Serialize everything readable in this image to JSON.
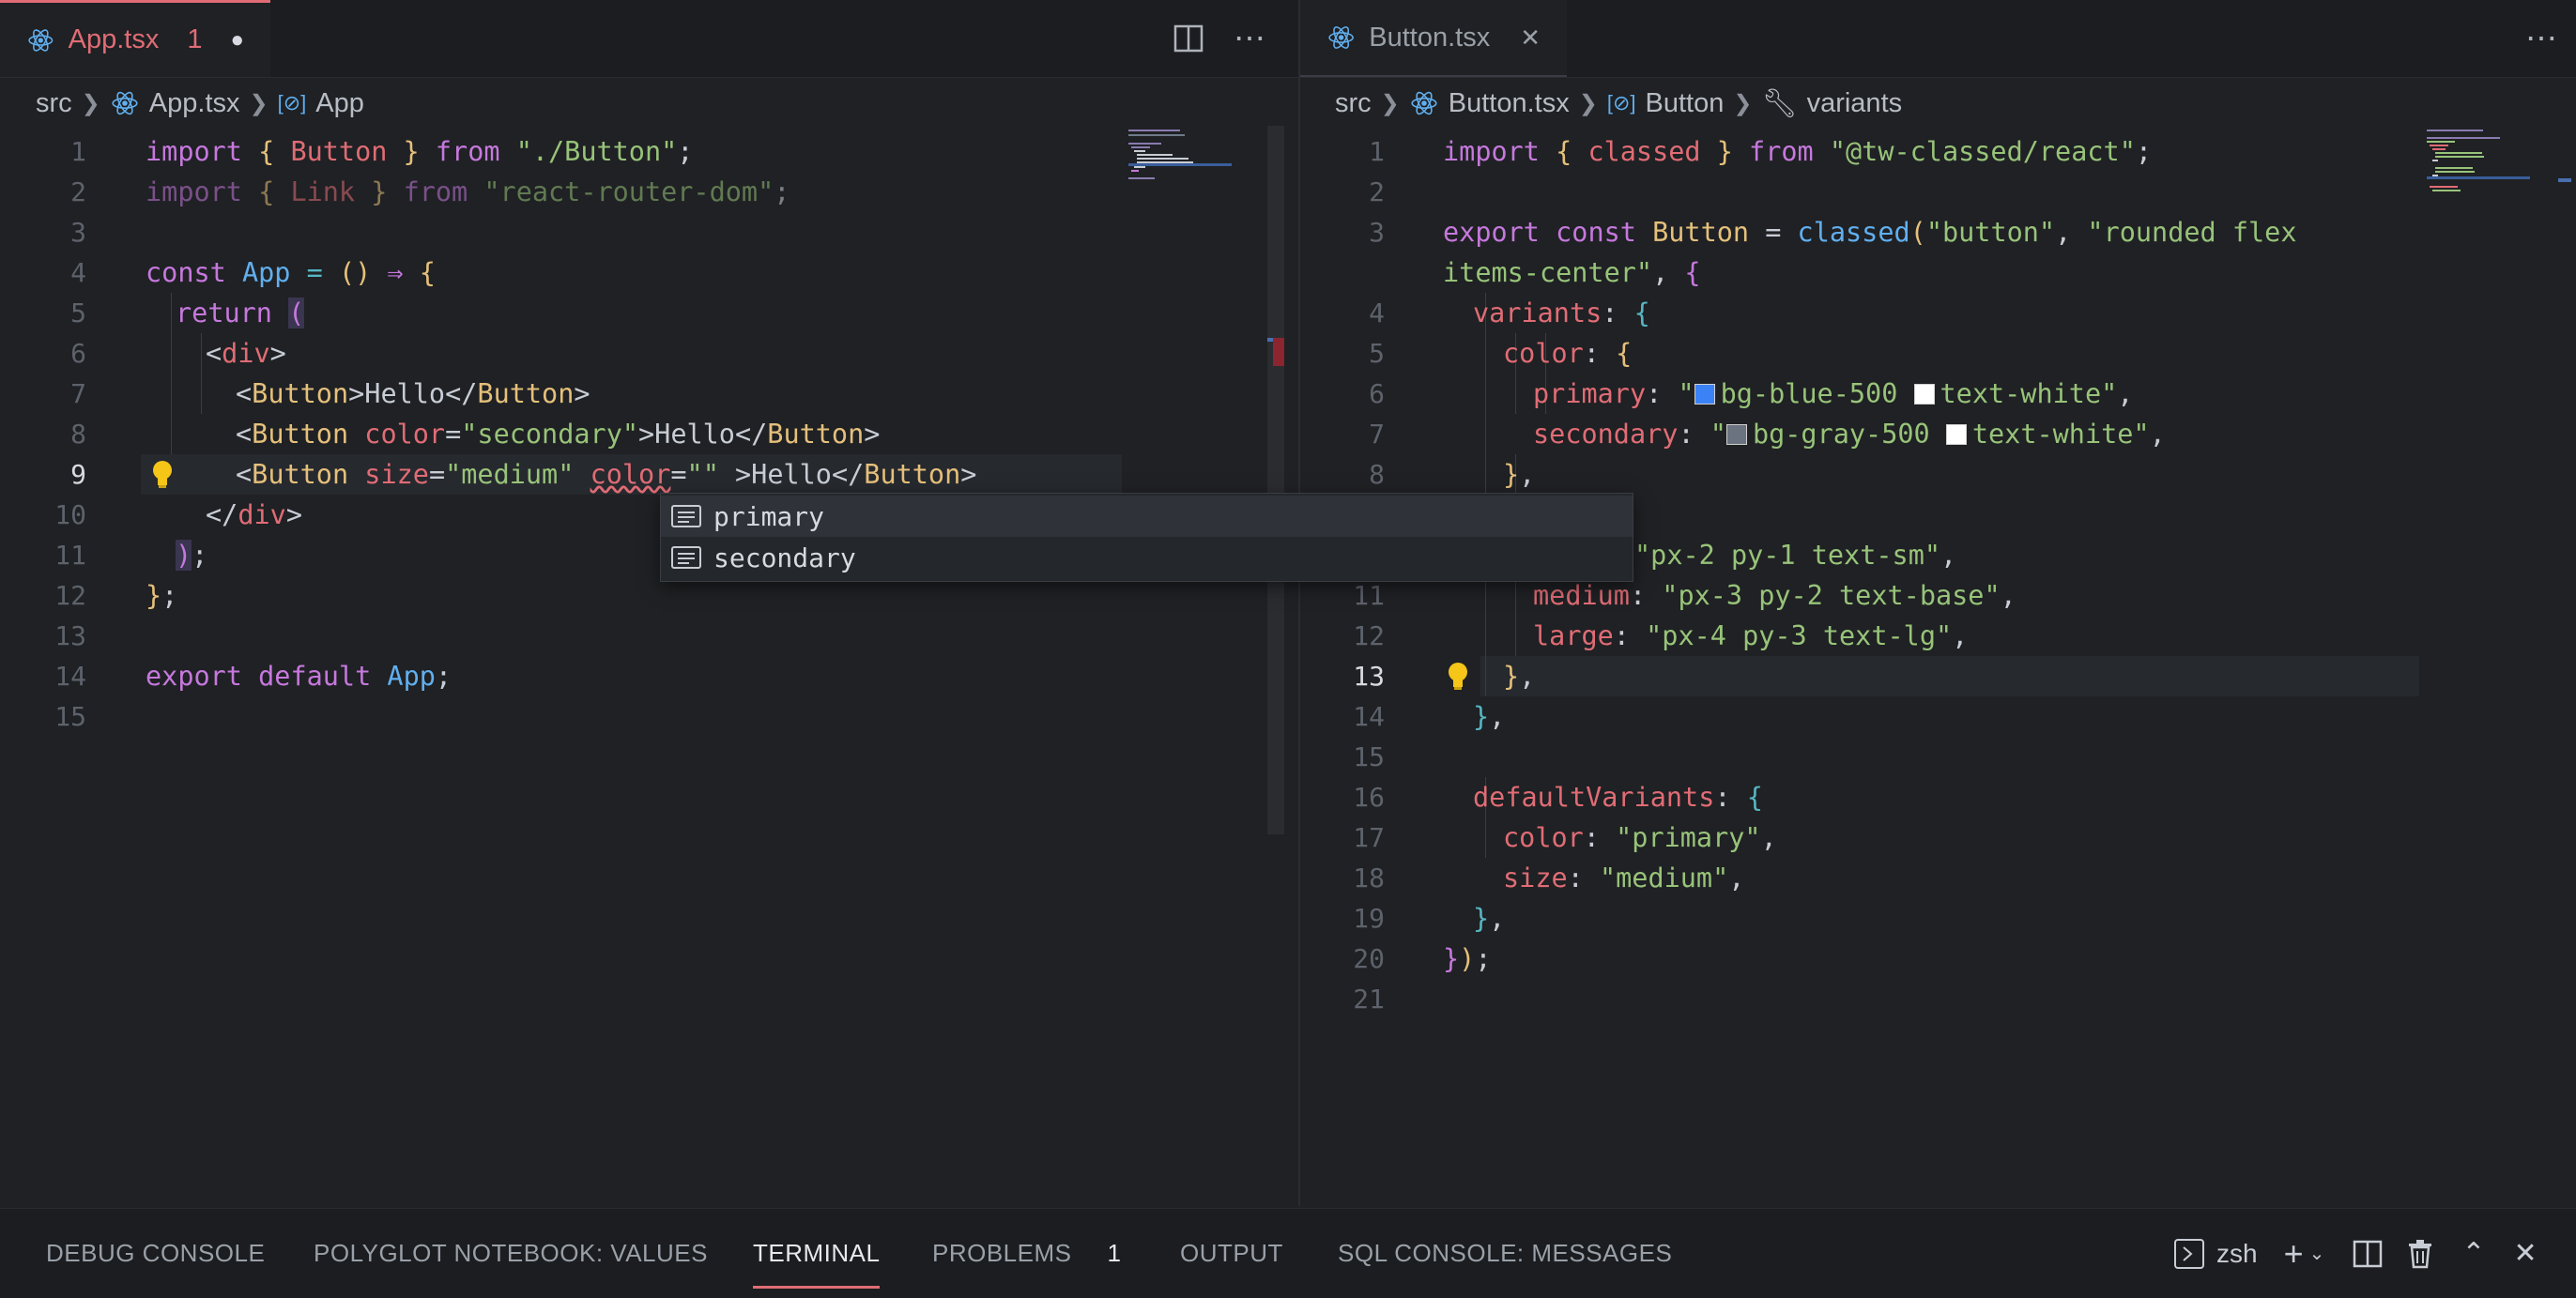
{
  "colors": {
    "accent": "#e06c75",
    "modified_tab": "#e06c75",
    "lightbulb": "#f5c518",
    "swatch_blue": "#3b82f6",
    "swatch_gray": "#6b7280",
    "swatch_white": "#ffffff"
  },
  "left": {
    "tab": {
      "label": "App.tsx",
      "problem_count": "1",
      "dirty_marker": "●",
      "icon": "react-icon"
    },
    "breadcrumb": [
      "src",
      "App.tsx",
      "App"
    ],
    "line_numbers": [
      "1",
      "2",
      "3",
      "4",
      "5",
      "6",
      "7",
      "8",
      "9",
      "10",
      "11",
      "12",
      "13",
      "14",
      "15"
    ],
    "current_line": "9"
  },
  "right": {
    "tab": {
      "label": "Button.tsx",
      "icon": "react-icon",
      "close": "✕"
    },
    "breadcrumb": [
      "src",
      "Button.tsx",
      "Button",
      "variants"
    ],
    "line_numbers": [
      "1",
      "2",
      "3",
      "",
      "4",
      "5",
      "6",
      "7",
      "8",
      "",
      "11",
      "12",
      "13",
      "14",
      "15",
      "16",
      "17",
      "18",
      "19",
      "20",
      "21"
    ],
    "current_line": "13"
  },
  "code": {
    "l1": [
      "import",
      " { ",
      "Button",
      " } ",
      "from",
      " ",
      "\"./Button\"",
      ";"
    ],
    "l2": [
      "import",
      " { ",
      "Link",
      " } ",
      "from",
      " ",
      "\"react-router-dom\"",
      ";"
    ],
    "l4": [
      "const",
      " ",
      "App",
      " = ",
      "()",
      " ⇒ ",
      "{"
    ],
    "l5": [
      "return",
      " ",
      "("
    ],
    "l6": [
      "<",
      "div",
      ">"
    ],
    "l7": [
      "<",
      "Button",
      ">Hello</",
      "Button",
      ">"
    ],
    "l8": [
      "<",
      "Button",
      " ",
      "color",
      "=",
      "\"secondary\"",
      ">Hello</",
      "Button",
      ">"
    ],
    "l9": [
      "<",
      "Button",
      " ",
      "size",
      "=",
      "\"medium\"",
      " ",
      "color",
      "=",
      "\"\"",
      " >Hello</",
      "Button",
      ">"
    ],
    "l10": [
      "</",
      "div",
      ">"
    ],
    "l11": [
      ")",
      ";"
    ],
    "l12": [
      "}",
      ";"
    ],
    "l14": [
      "export",
      " ",
      "default",
      " ",
      "App",
      ";"
    ]
  },
  "rcode": {
    "r1": [
      "import",
      " { ",
      "classed",
      " } ",
      "from",
      " ",
      "\"@tw-classed/react\"",
      ";"
    ],
    "r3": [
      "export",
      " ",
      "const",
      " ",
      "Button",
      " = ",
      "classed",
      "(",
      "\"button\"",
      ", ",
      "\"rounded flex"
    ],
    "r3b": [
      "items-center\"",
      ", ",
      "{"
    ],
    "r4": [
      "variants",
      ": ",
      "{"
    ],
    "r5": [
      "color",
      ": ",
      "{"
    ],
    "r6": [
      "primary",
      ": ",
      "\"",
      "bg-blue-500 ",
      "text-white\"",
      ","
    ],
    "r7": [
      "secondary",
      ": ",
      "\"",
      "bg-gray-500 ",
      "text-white\"",
      ","
    ],
    "r8": [
      "}",
      ","
    ],
    "r10": [
      "\"px-2 py-1 text-sm\"",
      ","
    ],
    "r11": [
      "medium",
      ": ",
      "\"px-3 py-2 text-base\"",
      ","
    ],
    "r12": [
      "large",
      ": ",
      "\"px-4 py-3 text-lg\"",
      ","
    ],
    "r13": [
      "}",
      ","
    ],
    "r14": [
      "}",
      ","
    ],
    "r16": [
      "defaultVariants",
      ": ",
      "{"
    ],
    "r17": [
      "color",
      ": ",
      "\"primary\"",
      ","
    ],
    "r18": [
      "size",
      ": ",
      "\"medium\"",
      ","
    ],
    "r19": [
      "}",
      ","
    ],
    "r20": [
      "}",
      ")",
      ";"
    ]
  },
  "suggestions": [
    "primary",
    "secondary"
  ],
  "panel": {
    "tabs": [
      "DEBUG CONSOLE",
      "POLYGLOT NOTEBOOK: VALUES",
      "TERMINAL",
      "PROBLEMS",
      "OUTPUT",
      "SQL CONSOLE: MESSAGES"
    ],
    "problems_count": "1",
    "terminal_name": "zsh"
  }
}
